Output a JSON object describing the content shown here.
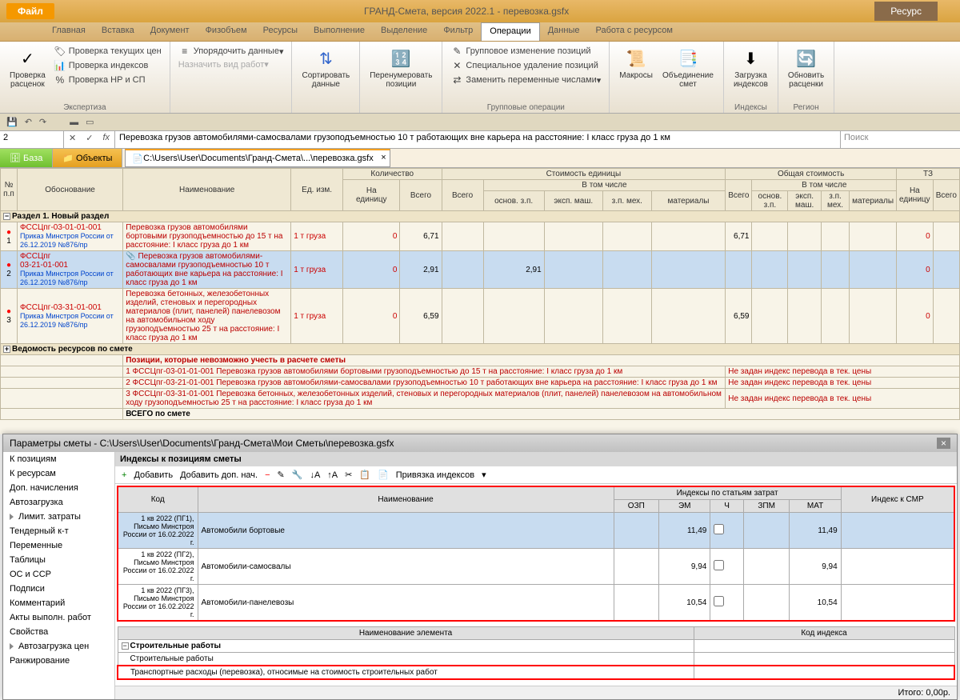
{
  "titlebar": {
    "file_label": "Файл",
    "app_title": "ГРАНД-Смета, версия 2022.1 - перевозка.gsfx",
    "resource_label": "Ресурс"
  },
  "menu_tabs": [
    "Главная",
    "Вставка",
    "Документ",
    "Физобъем",
    "Ресурсы",
    "Выполнение",
    "Выделение",
    "Фильтр",
    "Операции",
    "Данные",
    "Работа с ресурсом"
  ],
  "menu_active": "Операции",
  "ribbon": {
    "g1": {
      "label": "Экспертиза",
      "big": "Проверка\nрасценок",
      "items": [
        "Проверка текущих цен",
        "Проверка индексов",
        "Проверка НР и СП"
      ]
    },
    "g2": {
      "items": [
        "Упорядочить данные",
        "Назначить вид работ"
      ]
    },
    "g3": {
      "sort": "Сортировать\nданные",
      "renum": "Перенумеровать\nпозиции"
    },
    "g4": {
      "label": "Групповые операции",
      "items": [
        "Групповое изменение позиций",
        "Специальное удаление позиций",
        "Заменить переменные числами"
      ]
    },
    "g5": {
      "macros": "Макросы",
      "merge": "Объединение\nсмет"
    },
    "g6": {
      "load": "Загрузка\nиндексов",
      "label": "Индексы"
    },
    "g7": {
      "update": "Обновить\nрасценки",
      "label": "Регион"
    }
  },
  "formula_bar": {
    "cell_ref": "2",
    "fx": "fx",
    "formula": "Перевозка грузов автомобилями-самосвалами грузоподъемностью 10 т работающих вне карьера на расстояние: I класс груза до 1 км",
    "search_placeholder": "Поиск"
  },
  "tabrow2": {
    "base": "База",
    "objects": "Объекты",
    "file_tab": "C:\\Users\\User\\Documents\\Гранд-Смета\\...\\перевозка.gsfx"
  },
  "grid_headers": {
    "np": "№\nп.п",
    "obosn": "Обоснование",
    "naim": "Наименование",
    "ed": "Ед. изм.",
    "kol": "Количество",
    "stoim_ed": "Стоимость единицы",
    "obsh_stoim": "Общая стоимость",
    "tz": "ТЗ",
    "na_ed": "На\nединицу",
    "vsego": "Всего",
    "vtom": "В том числе",
    "osn": "основ. з.п.",
    "eksp": "эксп. маш.",
    "zpmex": "з.п. мех.",
    "mat": "материалы"
  },
  "grid_rows": {
    "section1": "Раздел 1. Новый раздел",
    "r1": {
      "n": "1",
      "code": "ФССЦпг-03-01-01-001",
      "order": "Приказ Минстроя России от 26.12.2019 №876/пр",
      "desc": "Перевозка грузов автомобилями бортовыми грузоподъемностью до 15 т на расстояние: I класс груза до 1 км",
      "unit": "1 т груза",
      "col1": "0",
      "col2": "6,71",
      "col3": "6,71",
      "col4": "0"
    },
    "r2": {
      "n": "2",
      "code": "ФССЦпг\n03-21-01-001",
      "order": "Приказ Минстроя России от 26.12.2019 №876/пр",
      "desc": "Перевозка грузов автомобилями-самосвалами грузоподъемностью 10 т работающих вне карьера на расстояние: I класс груза до 1 км",
      "unit": "1 т груза",
      "col1": "0",
      "col2": "2,91",
      "col3": "2,91",
      "col4": "0"
    },
    "r3": {
      "n": "3",
      "code": "ФССЦпг-03-31-01-001",
      "order": "Приказ Минстроя России от 26.12.2019 №876/пр",
      "desc": "Перевозка бетонных, железобетонных изделий, стеновых и перегородных материалов (плит, панелей) панелевозом на автомобильном ходу грузоподъемностью 25 т на расстояние: I класс груза до 1 км",
      "unit": "1 т груза",
      "col1": "0",
      "col2": "6,59",
      "col3": "6,59",
      "col4": "0"
    },
    "vedomost": "Ведомость ресурсов по смете",
    "poz_title": "Позиции, которые невозможно учесть в расчете сметы",
    "poz1": "1 ФССЦпг-03-01-01-001 Перевозка грузов автомобилями бортовыми грузоподъемностью до 15 т на расстояние: I класс груза до 1 км",
    "poz2": "2 ФССЦпг-03-21-01-001 Перевозка грузов автомобилями-самосвалами грузоподъемностью 10 т работающих вне карьера на расстояние: I класс груза до 1 км",
    "poz3": "3 ФССЦпг-03-31-01-001 Перевозка бетонных, железобетонных изделий, стеновых и перегородных материалов (плит, панелей) панелевозом на автомобильном ходу грузоподъемностью 25 т на расстояние: I класс груза до 1 км",
    "poz_note": "Не задан индекс перевода в тек. цены",
    "vsego_label": "ВСЕГО по смете"
  },
  "lower": {
    "title": "Параметры сметы - C:\\Users\\User\\Documents\\Гранд-Смета\\Мои Сметы\\перевозка.gsfx",
    "sidebar": [
      "К позициям",
      "К ресурсам",
      "Доп. начисления",
      "Автозагрузка",
      "Лимит. затраты",
      "Тендерный к-т",
      "Переменные",
      "Таблицы",
      "ОС и ССР",
      "Подписи",
      "Комментарий",
      "Акты выполн. работ",
      "Свойства",
      "Автозагрузка цен",
      "Ранжирование"
    ],
    "subtitle": "Индексы к позициям сметы",
    "toolbar": {
      "add": "Добавить",
      "add_dop": "Добавить доп. нач.",
      "bind": "Привязка индексов"
    },
    "grid_headers": {
      "kod": "Код",
      "naim": "Наименование",
      "ind_stat": "Индексы по статьям затрат",
      "ind_smr": "Индекс к СМР",
      "ozp": "ОЗП",
      "em": "ЭМ",
      "ch": "Ч",
      "zpm": "ЗПМ",
      "mat": "МАТ"
    },
    "idx_rows": [
      {
        "code": "1 кв 2022 (ПГ1), Письмо Минстроя России от 16.02.2022 г.",
        "name": "Автомобили бортовые",
        "em": "11,49",
        "mat": "11,49"
      },
      {
        "code": "1 кв 2022 (ПГ2), Письмо Минстроя России от 16.02.2022 г.",
        "name": "Автомобили-самосвалы",
        "em": "9,94",
        "mat": "9,94"
      },
      {
        "code": "1 кв 2022 (ПГ3), Письмо Минстроя России от 16.02.2022 г.",
        "name": "Автомобили-панелевозы",
        "em": "10,54",
        "mat": "10,54"
      }
    ],
    "naim_elem": "Наименование элемента",
    "kod_idx": "Код индекса",
    "stroit": "Строительные работы",
    "stroit2": "Строительные работы",
    "transport": "Транспортные расходы (перевозка), относимые на стоимость строительных работ",
    "status": "Итого: 0,00р."
  }
}
